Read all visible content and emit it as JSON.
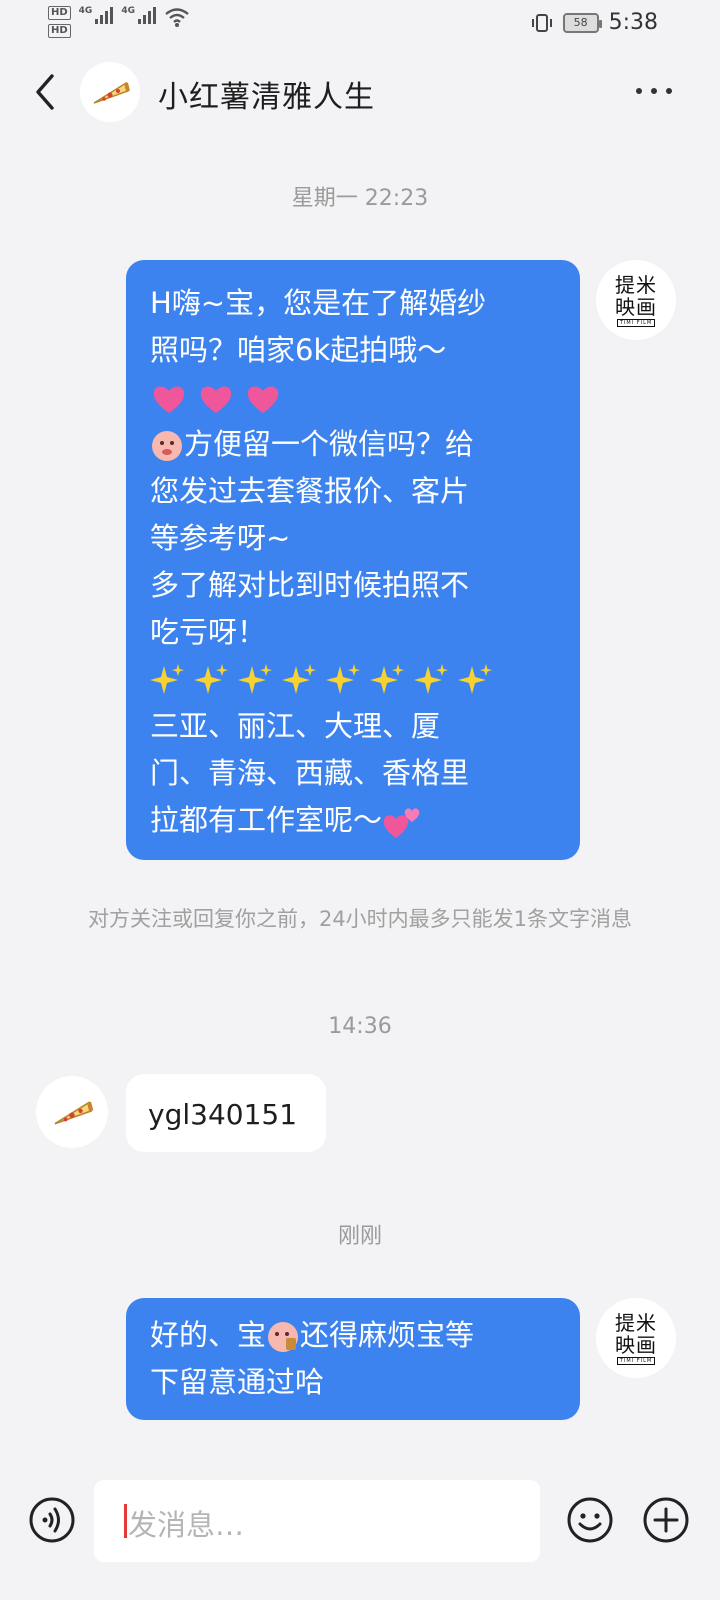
{
  "status_bar": {
    "hd1": "HD",
    "hd2": "HD",
    "net1": "4G",
    "net2": "4G",
    "battery": "58",
    "time": "5:38"
  },
  "header": {
    "title": "小红薯清雅人生",
    "back_icon": "chevron-left-icon",
    "more_icon": "more-dots-icon",
    "contact_avatar_icon": "pizza-slice-icon"
  },
  "messages": {
    "time1": "星期一 22:23",
    "msg1": {
      "line1": "H嗨~宝，您是在了解婚纱",
      "line2": "照吗？咱家6k起拍哦～",
      "line4": "方便留一个微信吗？给",
      "line5": "您发过去套餐报价、客片",
      "line6": "等参考呀~",
      "line7": "多了解对比到时候拍照不",
      "line8": "吃亏呀！",
      "line9": "三亚、丽江、大理、厦",
      "line10": "门、青海、西藏、香格里",
      "line11": "拉都有工作室呢～"
    },
    "notice": "对方关注或回复你之前，24小时内最多只能发1条文字消息",
    "time2": "14:36",
    "msg2": "ygl340151",
    "time3": "刚刚",
    "msg3": {
      "line1a": "好的、宝",
      "line1b": "还得麻烦宝等",
      "line2": "下留意通过哈"
    },
    "brand_avatar": {
      "line1": "提米",
      "line2": "映画",
      "sub": "TIMI FILM"
    }
  },
  "input": {
    "placeholder": "发消息…",
    "voice_icon": "voice-icon",
    "emoji_icon": "smiley-icon",
    "plus_icon": "plus-icon"
  },
  "colors": {
    "bubble_out": "#3c83ef",
    "background": "#f3f3f5"
  }
}
